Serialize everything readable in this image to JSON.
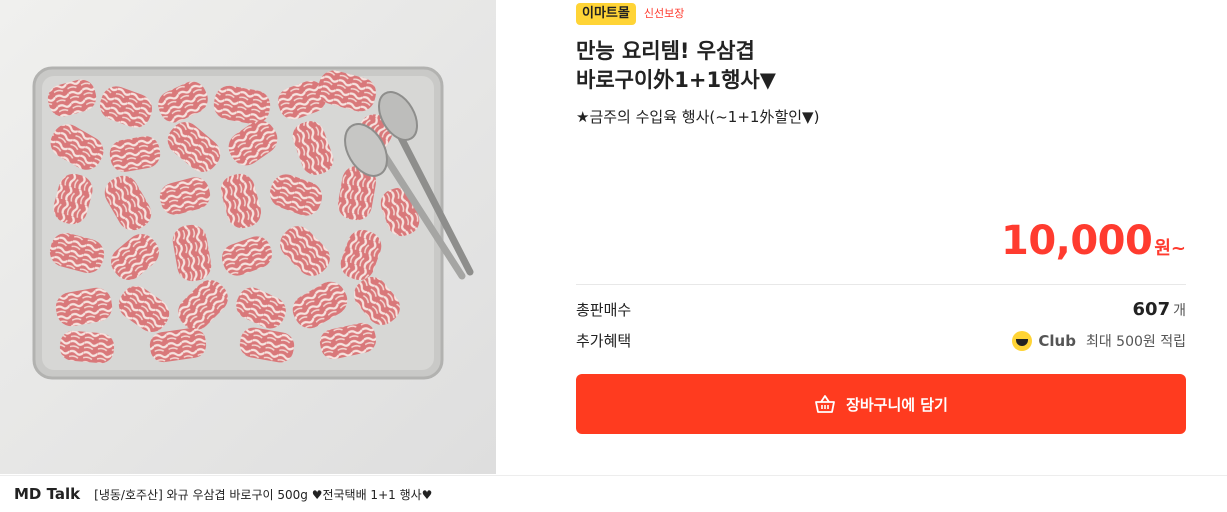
{
  "product": {
    "image_alt": "우삼겹 바로구이",
    "badges": {
      "mall": "이마트몰",
      "fresh": "신선보장"
    },
    "title": "만능 요리템! 우삼겹\n바로구이外1+1행사▼",
    "subtitle": "★금주의 수입육 행사(~1+1外할인▼)",
    "price": "10,000",
    "price_unit": "원~",
    "total_sales_label": "총판매수",
    "total_sales_value": "607",
    "total_sales_unit": "개",
    "extra_benefit_label": "추가혜택",
    "club_label": "Club",
    "club_benefit": "최대 500원 적립",
    "cart_button_label": "장바구니에 담기"
  },
  "md_talk": {
    "title": "MD Talk",
    "text": "[냉동/호주산] 와규 우삼겹 바로구이 500g ♥전국택배 1+1 행사♥"
  },
  "colors": {
    "accent": "#ff3b1f",
    "badge": "#ffd436"
  }
}
